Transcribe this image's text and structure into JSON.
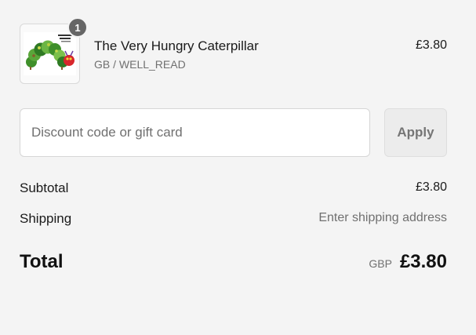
{
  "line_item": {
    "quantity": "1",
    "title": "The Very Hungry Caterpillar",
    "variant": "GB / WELL_READ",
    "price": "£3.80",
    "image_icon": "book-cover-caterpillar"
  },
  "discount": {
    "placeholder": "Discount code or gift card",
    "value": "",
    "apply_label": "Apply"
  },
  "summary": {
    "subtotal_label": "Subtotal",
    "subtotal_value": "£3.80",
    "shipping_label": "Shipping",
    "shipping_value": "Enter shipping address",
    "total_label": "Total",
    "currency": "GBP",
    "total_value": "£3.80"
  },
  "colors": {
    "background": "#f4f4f4",
    "badge": "#666666",
    "muted_text": "#707070",
    "caterpillar_green": "#3f8f2a",
    "caterpillar_head": "#d8262b"
  }
}
